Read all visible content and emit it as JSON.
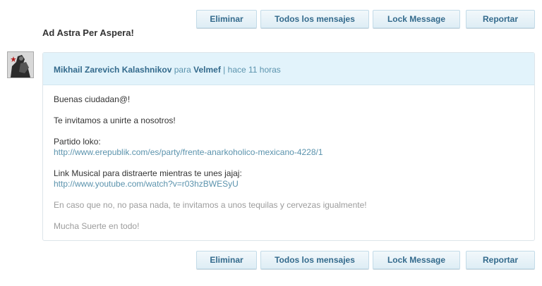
{
  "toolbar": {
    "delete_label": "Eliminar",
    "all_messages_label": "Todos los mensajes",
    "lock_label": "Lock Message",
    "report_label": "Reportar"
  },
  "message": {
    "subject": "Ad Astra Per Aspera!",
    "sender": "Mikhail Zarevich Kalashnikov",
    "to_word": "para",
    "recipient": "Velmef",
    "separator": "|",
    "time": "hace 11 horas",
    "lines": {
      "greeting": "Buenas ciudadan@!",
      "invite": "Te invitamos a unirte a nosotros!",
      "party_label": "Partido loko:",
      "party_url": "http://www.erepublik.com/es/party/frente-anarkoholico-mexicano-4228/1",
      "music_label": "Link Musical para distraerte mientras te unes jajaj:",
      "music_url": "http://www.youtube.com/watch?v=r03hzBWESyU",
      "fallback": "En caso que no, no pasa nada, te invitamos a unos tequilas y cervezas igualmente!",
      "closing": "Mucha Suerte en todo!"
    }
  }
}
